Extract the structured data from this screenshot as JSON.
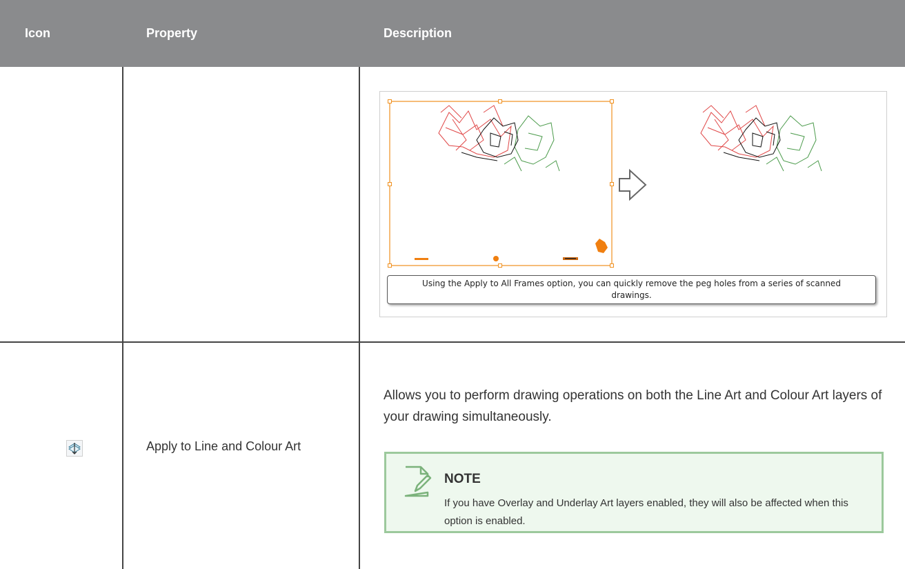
{
  "table": {
    "headers": {
      "icon": "Icon",
      "property": "Property",
      "description": "Description"
    },
    "rows": [
      {
        "figure": {
          "caption": "Using the Apply to All Frames option, you can quickly remove the peg holes from a series of scanned drawings."
        }
      },
      {
        "icon": "apply-to-line-and-colour-art-icon",
        "property": "Apply to Line and Colour Art",
        "description": "Allows you to perform drawing operations on both the Line Art and Colour Art layers of your drawing simultaneously.",
        "note": {
          "title": "NOTE",
          "body": "If you have Overlay and Underlay Art layers enabled, they will also be affected when this option is enabled."
        }
      }
    ]
  },
  "colors": {
    "header_bg": "#8a8b8d",
    "selection_orange": "#f0901e",
    "note_bg": "#eef8ee",
    "note_border": "#9cc99c",
    "lineart_red": "#e04848",
    "lineart_green": "#4a9a4a"
  }
}
